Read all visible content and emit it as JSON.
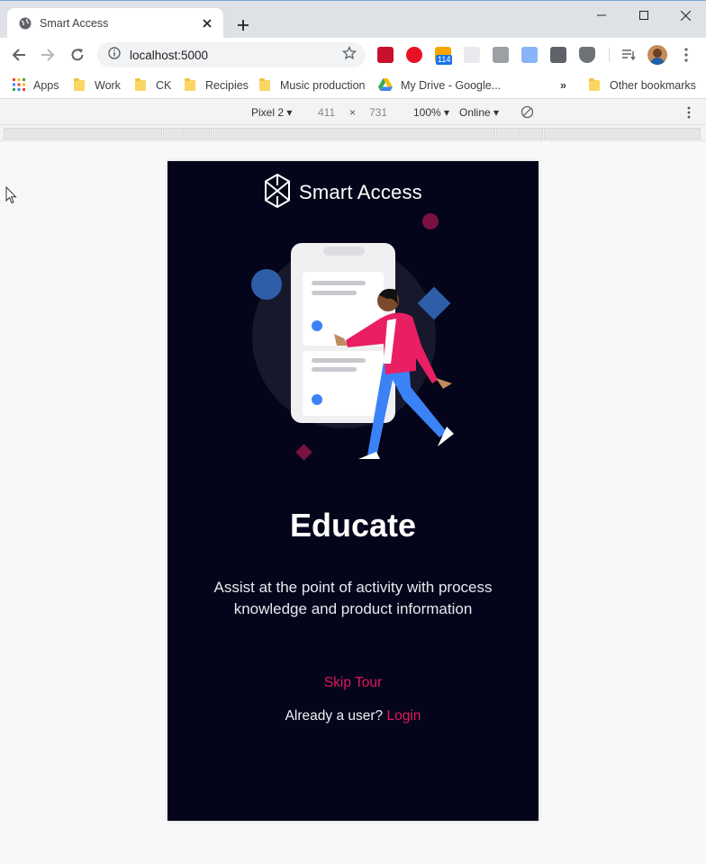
{
  "browser": {
    "tab_title": "Smart Access",
    "url": "localhost:5000",
    "bookmarks": [
      "Apps",
      "Work",
      "CK",
      "Recipies",
      "Music production",
      "My Drive - Google...",
      "Other bookmarks"
    ],
    "bookmarks_overflow": "»",
    "extension_badge": "114"
  },
  "devtools": {
    "device": "Pixel 2",
    "width": "411",
    "times": "×",
    "height": "731",
    "zoom": "100%",
    "network": "Online"
  },
  "app": {
    "brand": "Smart Access",
    "heading": "Educate",
    "description": "Assist at the point of activity with process knowledge and product information",
    "skip_label": "Skip Tour",
    "already_user": "Already a user?",
    "login_label": "Login"
  },
  "colors": {
    "app_background": "#04051a",
    "accent": "#e0195e",
    "blue": "#3b82f6",
    "jacket": "#e91e63",
    "maroon": "#7a1142"
  },
  "icons": [
    "globe-icon",
    "close-icon",
    "plus-icon",
    "minimize-icon",
    "maximize-icon",
    "back-icon",
    "forward-icon",
    "reload-icon",
    "info-icon",
    "star-icon",
    "reading-list-icon",
    "profile-avatar",
    "menu-icon",
    "apps-grid-icon",
    "folder-icon",
    "drive-icon",
    "rotate-icon",
    "more-icon",
    "cursor-icon",
    "smart-access-logo"
  ]
}
